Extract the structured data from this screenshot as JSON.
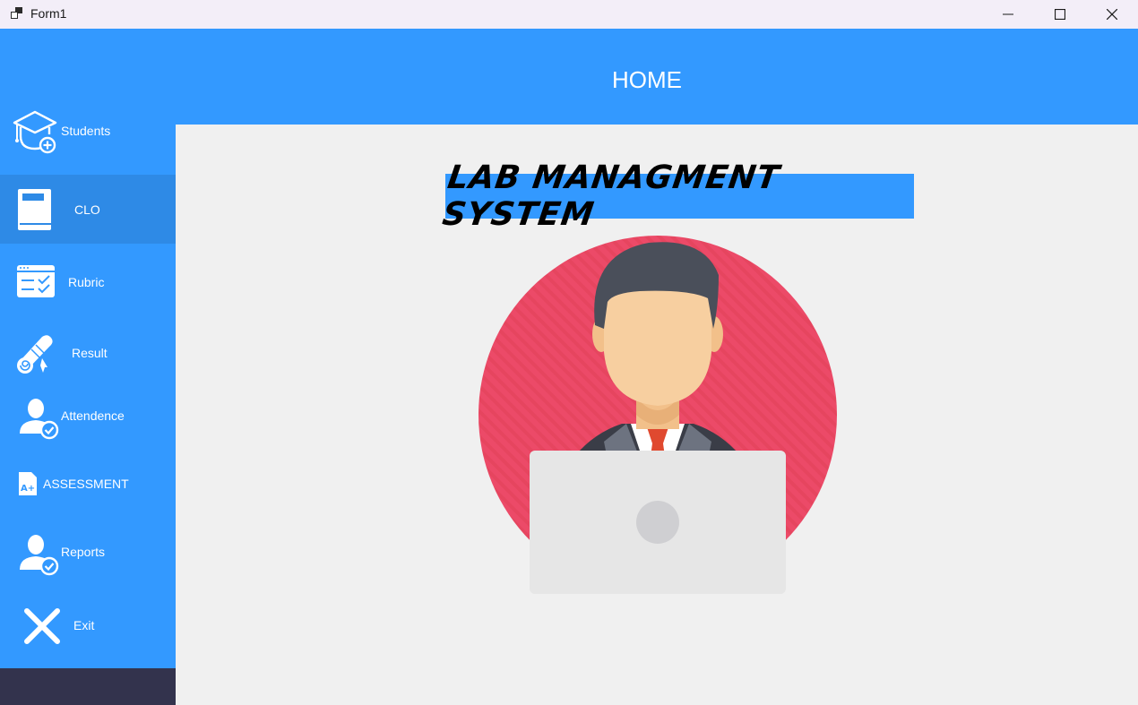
{
  "window": {
    "title": "Form1",
    "controls": [
      "minimize-icon",
      "maximize-icon",
      "close-icon"
    ]
  },
  "header": {
    "title": "HOME"
  },
  "sidebar": {
    "items": [
      {
        "label": "Students",
        "icon": "student-add-icon",
        "active": false
      },
      {
        "label": "CLO",
        "icon": "book-icon",
        "active": true
      },
      {
        "label": "Rubric",
        "icon": "checklist-window-icon",
        "active": false
      },
      {
        "label": "Result",
        "icon": "diploma-scroll-icon",
        "active": false
      },
      {
        "label": "Attendence",
        "icon": "user-check-icon",
        "active": false
      },
      {
        "label": "ASSESSMENT",
        "icon": "grade-document-icon",
        "active": false
      },
      {
        "label": "Reports",
        "icon": "user-check-icon",
        "active": false
      },
      {
        "label": "Exit",
        "icon": "close-x-icon",
        "active": false
      }
    ]
  },
  "main": {
    "banner_text": "Lab Managment System",
    "illustration": "person-at-laptop-icon"
  },
  "colors": {
    "accent": "#3399ff",
    "active_item": "#2e8ae6",
    "sidebar_footer": "#33334d",
    "content_bg": "#f0f0f0",
    "illustration_circle": "#ec4a68"
  }
}
